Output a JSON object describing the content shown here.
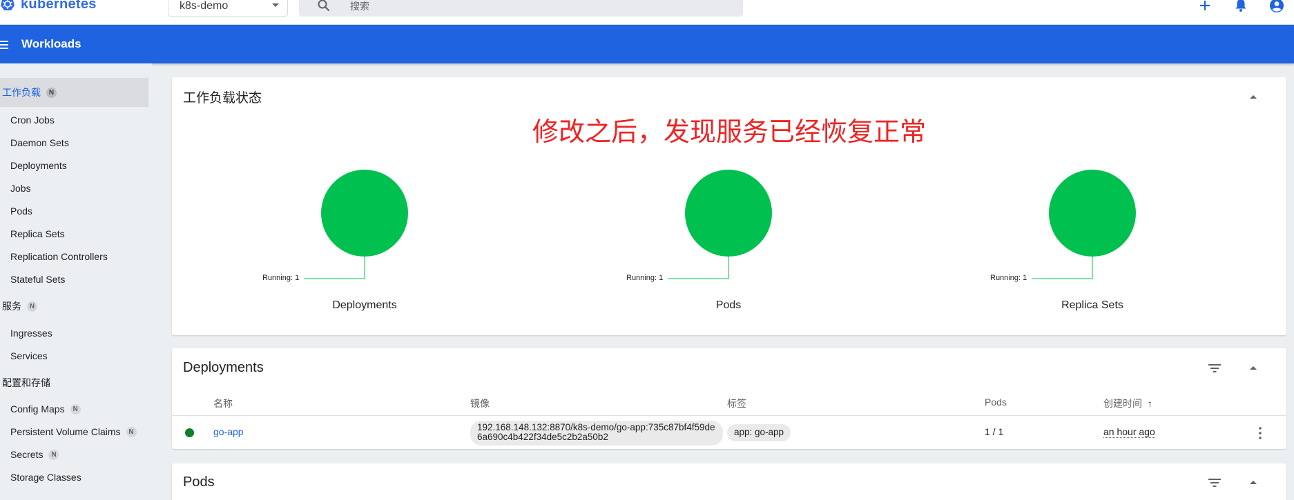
{
  "app": {
    "brand": "kubernetes",
    "namespace": "k8s-demo",
    "search_placeholder": "搜索"
  },
  "titlebar": {
    "title": "Workloads"
  },
  "sidebar": {
    "workloads": {
      "label": "工作负载",
      "badge": "N"
    },
    "workload_items": [
      "Cron Jobs",
      "Daemon Sets",
      "Deployments",
      "Jobs",
      "Pods",
      "Replica Sets",
      "Replication Controllers",
      "Stateful Sets"
    ],
    "service": {
      "label": "服务",
      "badge": "N"
    },
    "service_items": [
      "Ingresses",
      "Services"
    ],
    "config": {
      "label": "配置和存储"
    },
    "config_items": [
      {
        "label": "Config Maps",
        "badge": "N"
      },
      {
        "label": "Persistent Volume Claims",
        "badge": "N"
      },
      {
        "label": "Secrets",
        "badge": "N"
      },
      {
        "label": "Storage Classes",
        "badge": ""
      }
    ]
  },
  "status_card": {
    "title": "工作负载状态",
    "annotation": "修改之后，发现服务已经恢复正常",
    "charts": [
      {
        "name": "Deployments",
        "running_label": "Running: 1",
        "running": 1
      },
      {
        "name": "Pods",
        "running_label": "Running: 1",
        "running": 1
      },
      {
        "name": "Replica Sets",
        "running_label": "Running: 1",
        "running": 1
      }
    ]
  },
  "deployments": {
    "title": "Deployments",
    "columns": {
      "name": "名称",
      "image": "镜像",
      "labels": "标签",
      "pods": "Pods",
      "created": "创建时间",
      "sort_arrow": "↑"
    },
    "rows": [
      {
        "name": "go-app",
        "image": "192.168.148.132:8870/k8s-demo/go-app:735c87bf4f59de6a690c4b422f34de5c2b2a50b2",
        "label": "app: go-app",
        "pods": "1 / 1",
        "created": "an hour ago"
      }
    ]
  },
  "pods": {
    "title": "Pods"
  },
  "colors": {
    "primary": "#1f63e0",
    "brand": "#326ce5",
    "running": "#00c050",
    "annotation": "#ee2424",
    "status_ok": "#0f7d2c"
  }
}
